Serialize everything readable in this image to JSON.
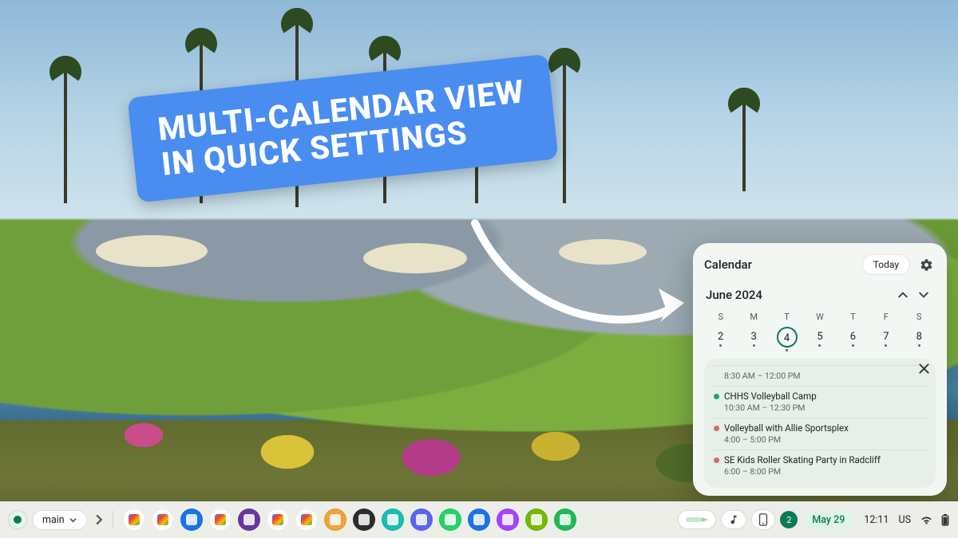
{
  "annotation": {
    "line1": "MULTI-CALENDAR VIEW",
    "line2": "IN QUICK SETTINGS"
  },
  "calendar": {
    "title": "Calendar",
    "today_label": "Today",
    "month_label": "June 2024",
    "dow": [
      "S",
      "M",
      "T",
      "W",
      "T",
      "F",
      "S"
    ],
    "dates": [
      2,
      3,
      4,
      5,
      6,
      7,
      8
    ],
    "selected_index": 2,
    "events": [
      {
        "color": "",
        "name": "",
        "time": "8:30 AM – 12:00 PM"
      },
      {
        "color": "#1aa383",
        "name": "CHHS Volleyball Camp",
        "time": "10:30 AM – 12:30 PM"
      },
      {
        "color": "#e06a4f",
        "name": "Volleyball with Allie Sportsplex",
        "time": "4:00 – 5:00 PM"
      },
      {
        "color": "#e06a4f",
        "name": "SE Kids Roller Skating Party in Radcliff",
        "time": "6:00 – 8:00 PM"
      }
    ]
  },
  "shelf": {
    "desk_label": "main",
    "apps": [
      {
        "name": "chrome",
        "bg": "#ffffff"
      },
      {
        "name": "gemini",
        "bg": "#ffffff"
      },
      {
        "name": "files",
        "bg": "#1a73e8"
      },
      {
        "name": "analytics",
        "bg": "#ffffff"
      },
      {
        "name": "zebra",
        "bg": "#6a34a0"
      },
      {
        "name": "calendar",
        "bg": "#ffffff"
      },
      {
        "name": "docs",
        "bg": "#ffffff"
      },
      {
        "name": "round-o",
        "bg": "#f0a23c"
      },
      {
        "name": "rainbow",
        "bg": "#2d2d2d"
      },
      {
        "name": "canva",
        "bg": "#19bdb2"
      },
      {
        "name": "discord",
        "bg": "#5865f2"
      },
      {
        "name": "whatsapp",
        "bg": "#25d366"
      },
      {
        "name": "messages",
        "bg": "#1a73e8"
      },
      {
        "name": "messenger",
        "bg": "#a544ff"
      },
      {
        "name": "nvidia",
        "bg": "#76b900"
      },
      {
        "name": "spotify",
        "bg": "#1db954"
      }
    ],
    "tray": {
      "notification_count": "2",
      "date": "May 29",
      "time": "12:11",
      "lang": "US"
    }
  }
}
